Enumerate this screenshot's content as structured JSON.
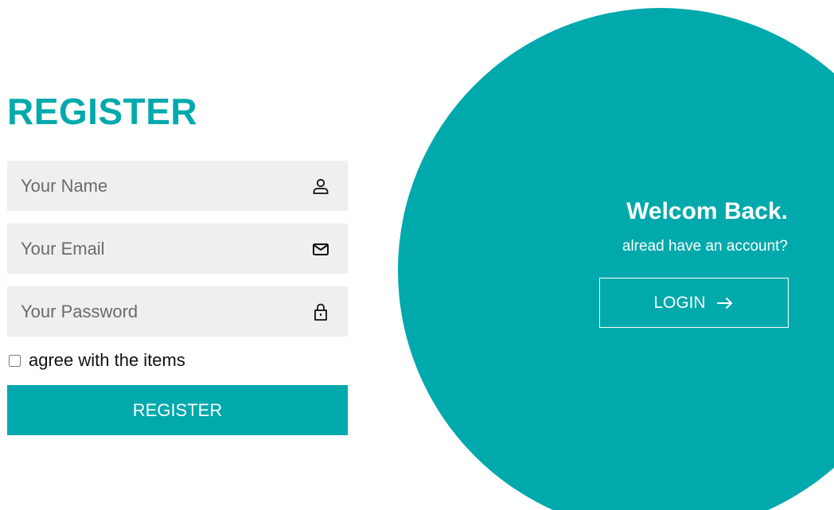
{
  "register": {
    "title": "REGISTER",
    "name_placeholder": "Your Name",
    "email_placeholder": "Your Email",
    "password_placeholder": "Your Password",
    "agree_label": "agree with the items",
    "agree_checked": false,
    "submit_label": "REGISTER"
  },
  "login_panel": {
    "heading": "Welcom Back.",
    "subtext": "alread have an account?",
    "button_label": "LOGIN"
  },
  "icons": {
    "name": "user-icon",
    "email": "envelope-icon",
    "password": "lock-icon",
    "login": "arrow-right-icon"
  },
  "colors": {
    "accent": "#00a9ac",
    "field_bg": "#efefef"
  }
}
